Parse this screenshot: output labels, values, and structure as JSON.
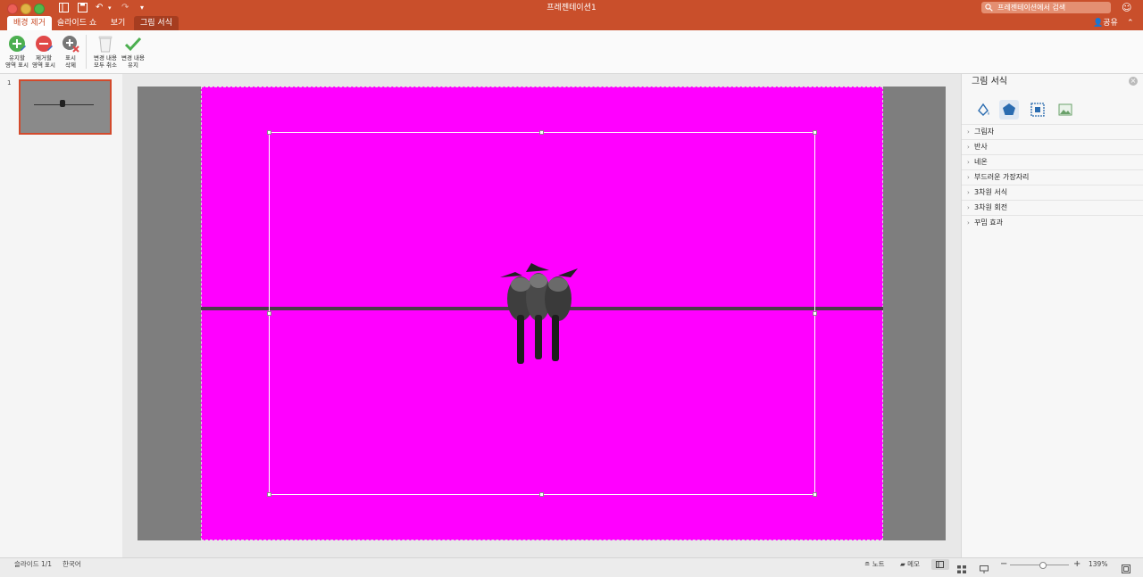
{
  "window": {
    "title": "프레젠테이션1",
    "search_placeholder": "프레젠테이션에서 검색",
    "share_label": "공유"
  },
  "tabs": [
    {
      "label": "배경 제거"
    },
    {
      "label": "슬라이드 쇼"
    },
    {
      "label": "보기"
    },
    {
      "label": "그림 서식"
    }
  ],
  "ribbon": {
    "buttons": [
      {
        "label": "유지할\n영역 표시",
        "icon": "plus-circle-icon"
      },
      {
        "label": "제거할\n영역 표시",
        "icon": "minus-circle-icon"
      },
      {
        "label": "표시\n삭제",
        "icon": "delete-mark-icon"
      },
      {
        "label": "변경 내용\n모두 취소",
        "icon": "trash-icon"
      },
      {
        "label": "변경 내용\n유지",
        "icon": "checkmark-icon"
      }
    ]
  },
  "thumbnails": [
    {
      "number": "1"
    }
  ],
  "format_pane": {
    "title": "그림 서식",
    "sections": [
      "그림자",
      "반사",
      "네온",
      "부드러운 가장자리",
      "3차원 서식",
      "3차원 회전",
      "꾸밈 효과"
    ]
  },
  "status": {
    "slide": "슬라이드 1/1",
    "language": "한국어",
    "notes_label": "노트",
    "comments_label": "메모",
    "zoom": "139%"
  },
  "colors": {
    "accent": "#c94f2b",
    "background_removal": "#ff00ff"
  }
}
